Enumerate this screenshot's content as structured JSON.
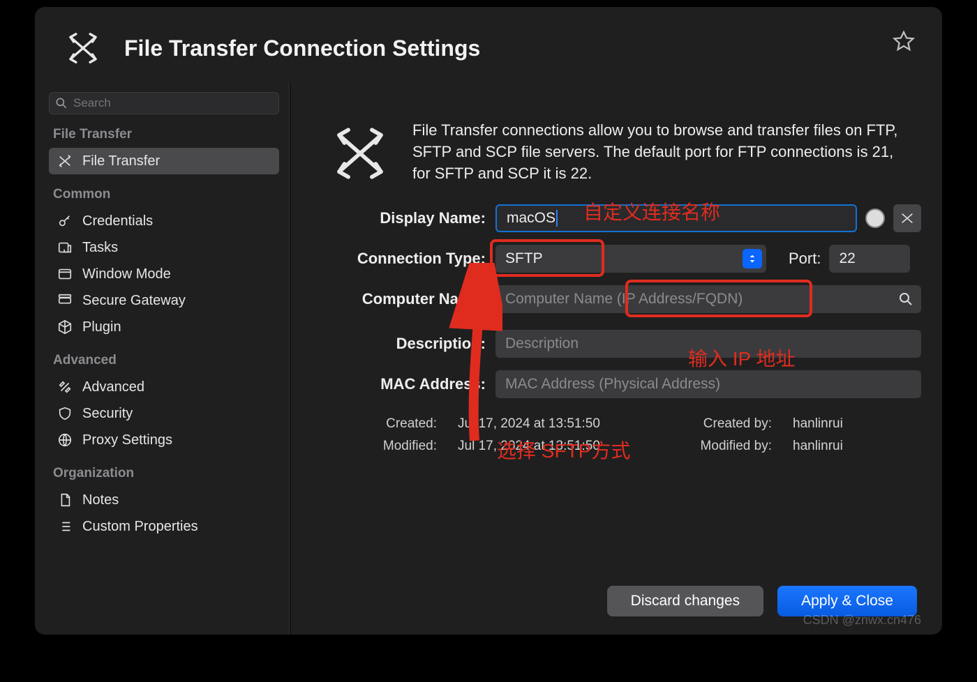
{
  "window": {
    "title": "File Transfer Connection Settings"
  },
  "sidebar": {
    "search_placeholder": "Search",
    "categories": [
      {
        "name": "File Transfer",
        "items": [
          {
            "label": "File Transfer",
            "icon": "swap",
            "active": true
          }
        ]
      },
      {
        "name": "Common",
        "items": [
          {
            "label": "Credentials",
            "icon": "key"
          },
          {
            "label": "Tasks",
            "icon": "task"
          },
          {
            "label": "Window Mode",
            "icon": "window"
          },
          {
            "label": "Secure Gateway",
            "icon": "gateway"
          },
          {
            "label": "Plugin",
            "icon": "cube"
          }
        ]
      },
      {
        "name": "Advanced",
        "items": [
          {
            "label": "Advanced",
            "icon": "tools"
          },
          {
            "label": "Security",
            "icon": "shield"
          },
          {
            "label": "Proxy Settings",
            "icon": "globe"
          }
        ]
      },
      {
        "name": "Organization",
        "items": [
          {
            "label": "Notes",
            "icon": "doc"
          },
          {
            "label": "Custom Properties",
            "icon": "list"
          }
        ]
      }
    ]
  },
  "main": {
    "intro": "File Transfer connections allow you to browse and transfer files on FTP, SFTP and SCP file servers. The default port for FTP connections is 21, for SFTP and SCP it is 22.",
    "labels": {
      "display_name": "Display Name:",
      "connection_type": "Connection Type:",
      "port": "Port:",
      "computer_name": "Computer Name:",
      "description": "Description:",
      "mac_address": "MAC Address:"
    },
    "values": {
      "display_name": "macOS",
      "connection_type": "SFTP",
      "port": "22"
    },
    "placeholders": {
      "computer_name": "Computer Name (IP Address/FQDN)",
      "description": "Description",
      "mac_address": "MAC Address (Physical Address)"
    },
    "meta": {
      "created_label": "Created:",
      "created_value": "Jul 17, 2024 at 13:51:50",
      "created_by_label": "Created by:",
      "created_by_value": "hanlinrui",
      "modified_label": "Modified:",
      "modified_value": "Jul 17, 2024 at 13:51:50",
      "modified_by_label": "Modified by:",
      "modified_by_value": "hanlinrui"
    }
  },
  "footer": {
    "discard": "Discard changes",
    "apply": "Apply & Close"
  },
  "annotations": {
    "custom_name": "自定义连接名称",
    "select_sftp": "选择 SFTP方式",
    "enter_ip": "输入 IP 地址"
  },
  "watermark": "CSDN @znwx.cn476"
}
